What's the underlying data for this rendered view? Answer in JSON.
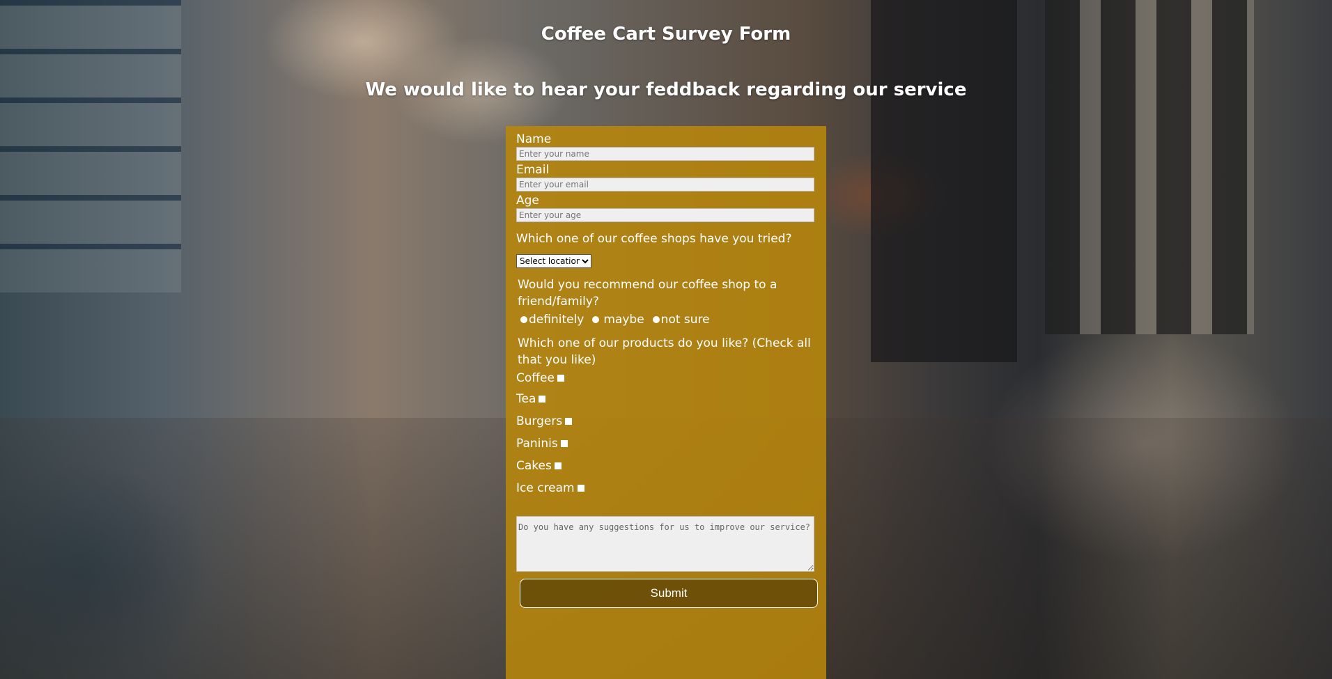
{
  "header": {
    "title": "Coffee Cart Survey Form",
    "subtitle": "We would like to hear your feddback regarding our service"
  },
  "form": {
    "name_label": "Name",
    "name_placeholder": "Enter your name",
    "email_label": "Email",
    "email_placeholder": "Enter your email",
    "age_label": "Age",
    "age_placeholder": "Enter your age",
    "shops_question": "Which one of our coffee shops have you tried?",
    "shops_select": {
      "selected": "Select location",
      "options": [
        "Select location"
      ]
    },
    "recommend_question": "Would you recommend our coffee shop to a friend/family?",
    "recommend_options": [
      "definitely",
      "maybe",
      "not sure"
    ],
    "products_question": "Which one of our products do you like? (Check all that you like)",
    "products": [
      "Coffee",
      "Tea",
      "Burgers",
      "Paninis",
      "Cakes",
      "Ice cream"
    ],
    "suggestions_placeholder": "Do you have any suggestions for us to improve our service?",
    "submit_label": "Submit"
  },
  "colors": {
    "panel": "#b8860b",
    "text": "#ffffff"
  }
}
